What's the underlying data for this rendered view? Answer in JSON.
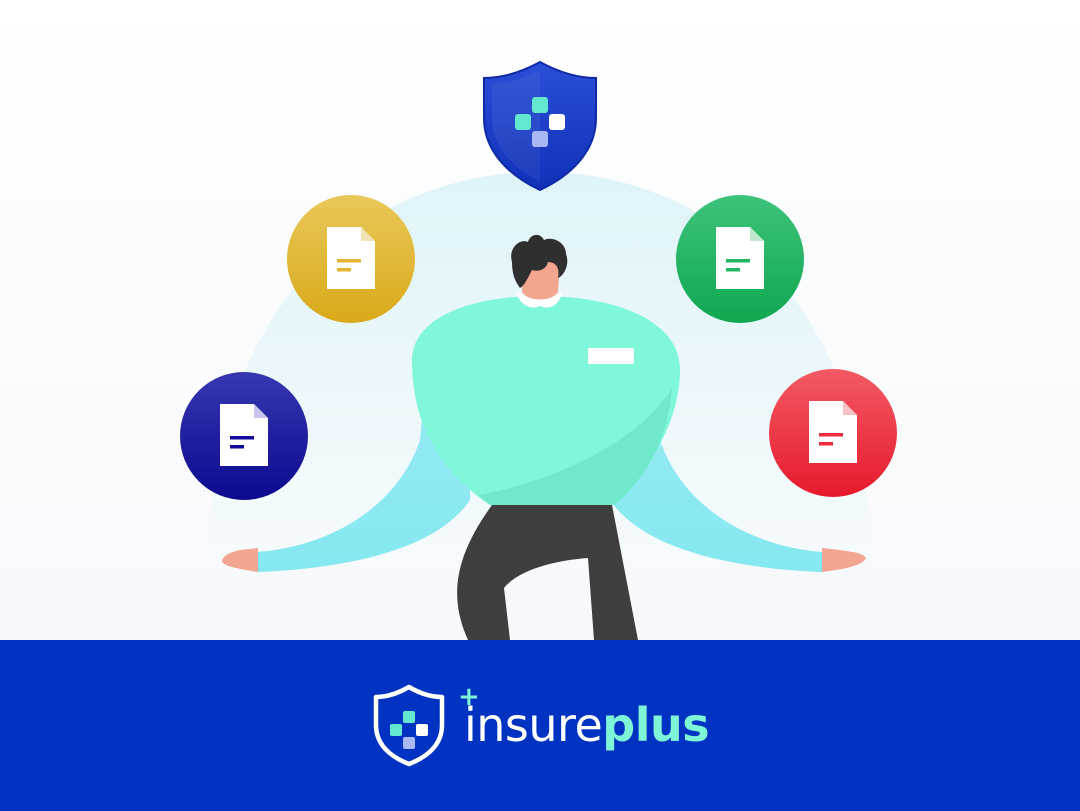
{
  "brand": {
    "name_part1": "insure",
    "name_part2": "plus",
    "logo_icon": "shield-plus-icon"
  },
  "illustration": {
    "shield_icon": "shield-plus-icon",
    "document_icons": [
      "document-icon",
      "document-icon",
      "document-icon",
      "document-icon"
    ]
  },
  "colors": {
    "footer_bg": "#0033c1",
    "accent": "#7ff5d8",
    "shield": "#1439c8",
    "doc_navy": "#120a9a",
    "doc_gold": "#e3b531",
    "doc_green": "#1fb661",
    "doc_red": "#ee2c3c",
    "shirt": "#7ff5d8",
    "arms": "#8ee9f1"
  }
}
